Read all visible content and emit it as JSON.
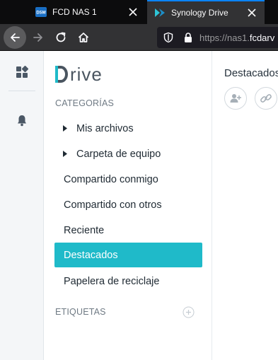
{
  "browser": {
    "tabs": [
      {
        "title": "FCD NAS 1",
        "favicon": "dsm-icon",
        "active": false
      },
      {
        "title": "Synology Drive",
        "favicon": "synology-drive-icon",
        "active": true
      }
    ],
    "url_prefix": "https://nas1.",
    "url_rest": "fcdarv"
  },
  "app": {
    "logo_text": "rive",
    "categories_label": "CATEGORÍAS",
    "nav": [
      {
        "label": "Mis archivos",
        "expandable": true
      },
      {
        "label": "Carpeta de equipo",
        "expandable": true
      },
      {
        "label": "Compartido conmigo"
      },
      {
        "label": "Compartido con otros"
      },
      {
        "label": "Reciente"
      },
      {
        "label": "Destacados",
        "selected": true
      },
      {
        "label": "Papelera de reciclaje"
      }
    ],
    "tags_label": "ETIQUETAS",
    "main_title": "Destacados",
    "accent_color": "#1fbac9"
  }
}
